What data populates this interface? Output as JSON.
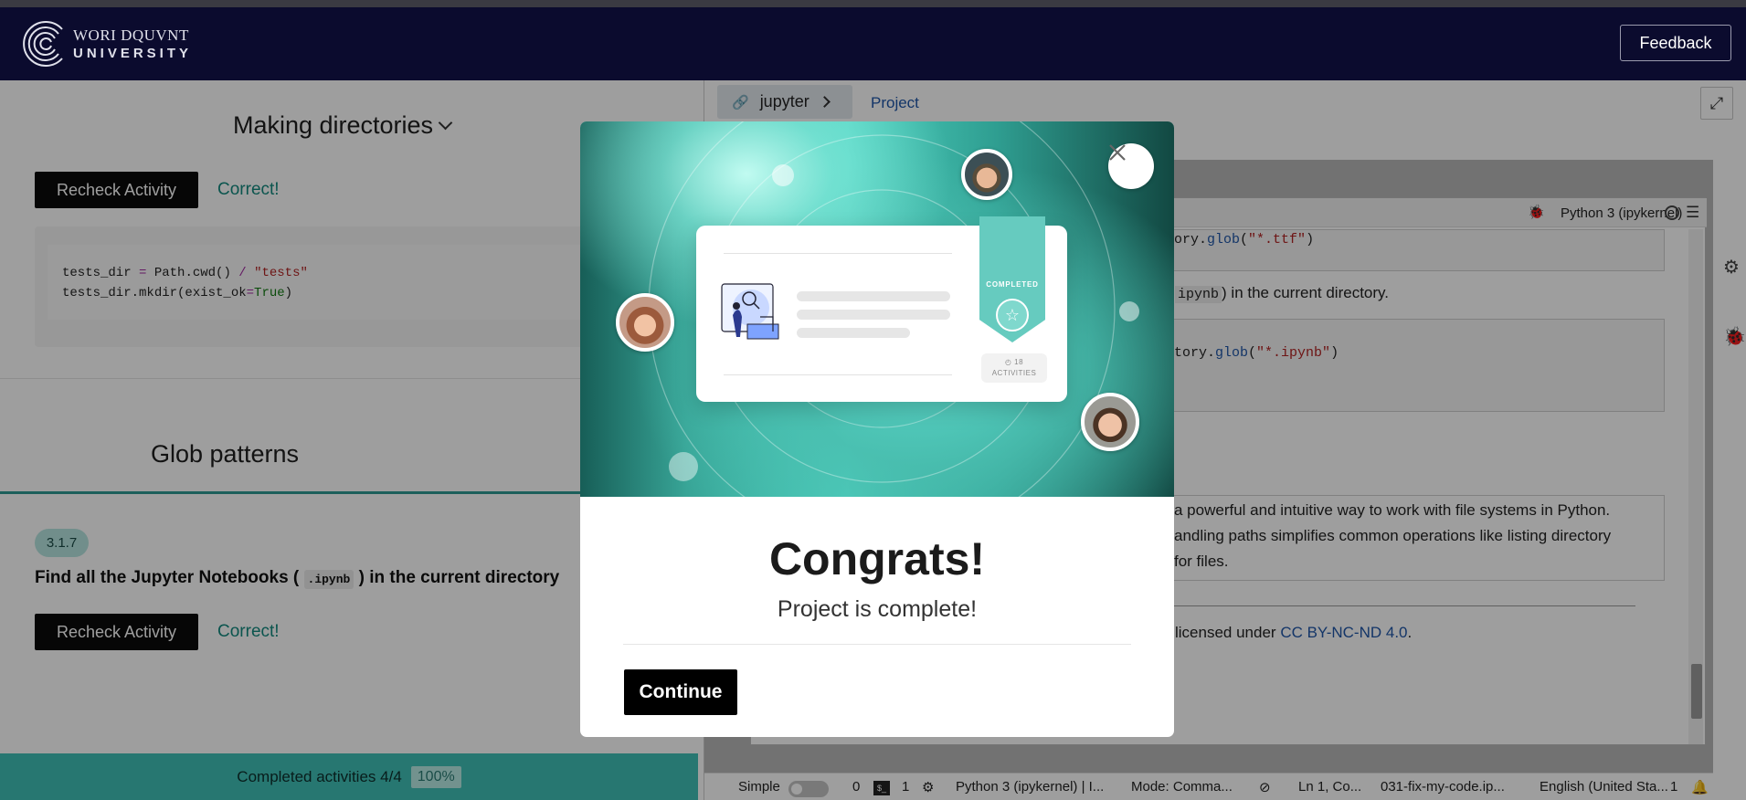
{
  "header": {
    "logo_line1": "WORI DQUVNT",
    "logo_line2": "UNIVERSITY",
    "feedback_label": "Feedback"
  },
  "left": {
    "section1_title": "Making directories",
    "recheck_label": "Recheck Activity",
    "correct_label": "Correct!",
    "code": {
      "l1_a": "tests_dir",
      "l1_eq": " = ",
      "l1_b": "Path.cwd() ",
      "l1_op": "/",
      "l1_str": " \"tests\"",
      "l2_a": "tests_dir.mkdir(exist_ok",
      "l2_eq": "=",
      "l2_kw": "True",
      "l2_end": ")"
    },
    "section2_title": "Glob patterns",
    "badge": "3.1.7",
    "task_title_pre": "Find all the Jupyter Notebooks ( ",
    "task_title_code": ".ipynb",
    "task_title_post": " ) in the current directory",
    "recheck_label_2": "Recheck Activity",
    "correct_label_2": "Correct!",
    "progress_text": "Completed activities 4/4",
    "progress_percent": "100%",
    "progress_value": 1.0
  },
  "right": {
    "tab_label": "jupyter",
    "project_link": "Project",
    "kernel": "Python 3 (ipykernel)",
    "cell1_code_a": "ory.",
    "cell1_code_b": "glob",
    "cell1_code_c": "(",
    "cell1_code_str": "\"*.ttf\"",
    "cell1_code_d": ")",
    "text1_code": "ipynb",
    "text1_rest": " in the current directory.",
    "cell2_code_a": "tory.",
    "cell2_code_b": "glob",
    "cell2_code_c": "(",
    "cell2_code_str": "\"*.ipynb\"",
    "cell2_code_d": ")",
    "para_line1": "a powerful and intuitive way to work with file systems in Python.",
    "para_line2": "andling paths simplifies common operations like listing directory",
    "para_line3": "for files.",
    "license_pre": "licensed under ",
    "license_link": "CC BY-NC-ND 4.0",
    "license_post": ".",
    "status": {
      "simple": "Simple",
      "zero": "0",
      "one": "1",
      "kernel": "Python 3 (ipykernel) | I...",
      "mode": "Mode: Comma...",
      "ln": "Ln 1, Co...",
      "file": "031-fix-my-code.ip...",
      "lang": "English (United Sta...",
      "notif": "1"
    }
  },
  "modal": {
    "ribbon_text": "COMPLETED",
    "activities_count": "18",
    "activities_label": "ACTIVITIES",
    "title": "Congrats!",
    "subtitle": "Project is complete!",
    "continue_label": "Continue"
  }
}
